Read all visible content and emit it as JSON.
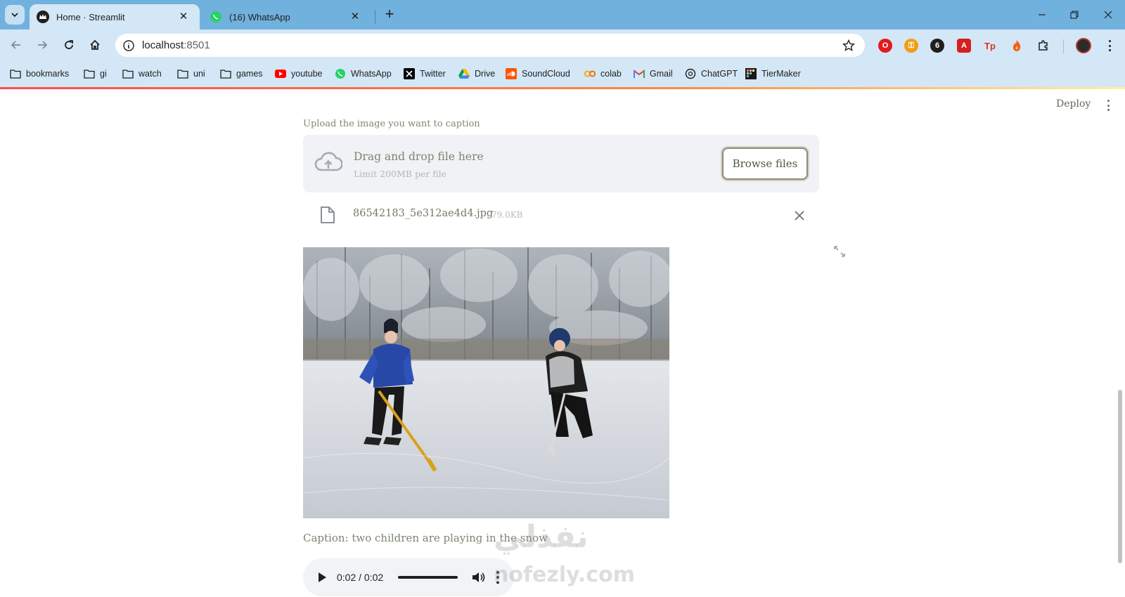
{
  "browser": {
    "tabs": [
      {
        "title": "Home · Streamlit",
        "active": true,
        "icon": "streamlit-crown-icon"
      },
      {
        "title": "(16) WhatsApp",
        "active": false,
        "icon": "whatsapp-icon"
      }
    ],
    "url": {
      "host": "localhost",
      "port": ":8501"
    },
    "bookmarks": [
      {
        "label": "bookmarks",
        "icon": "folder-icon"
      },
      {
        "label": "gi",
        "icon": "folder-icon"
      },
      {
        "label": "watch",
        "icon": "folder-icon"
      },
      {
        "label": "uni",
        "icon": "folder-icon"
      },
      {
        "label": "games",
        "icon": "folder-icon"
      },
      {
        "label": "youtube",
        "icon": "youtube-icon"
      },
      {
        "label": "WhatsApp",
        "icon": "whatsapp-icon"
      },
      {
        "label": "Twitter",
        "icon": "x-icon"
      },
      {
        "label": "Drive",
        "icon": "drive-icon"
      },
      {
        "label": "SoundCloud",
        "icon": "soundcloud-icon"
      },
      {
        "label": "colab",
        "icon": "colab-icon"
      },
      {
        "label": "Gmail",
        "icon": "gmail-icon"
      },
      {
        "label": "ChatGPT",
        "icon": "chatgpt-icon"
      },
      {
        "label": "TierMaker",
        "icon": "tiermaker-icon"
      }
    ],
    "extension_labels": {
      "tp": "Tp"
    }
  },
  "app": {
    "header": {
      "deploy_label": "Deploy"
    },
    "uploader": {
      "label": "Upload the image you want to caption",
      "drop_title": "Drag and drop file here",
      "limit": "Limit 200MB per file",
      "browse_label": "Browse files"
    },
    "uploaded_file": {
      "name": "86542183_5e312ae4d4.jpg",
      "size": "79.0KB"
    },
    "image": {
      "subject": "two children playing ice hockey on a frozen lake with snowy trees"
    },
    "caption": "Caption: two children are playing in the snow",
    "audio": {
      "time": "0:02 / 0:02",
      "progress": 1.0
    }
  },
  "watermark": {
    "arabic": "نفذلي",
    "latin": "nofezly.com"
  },
  "colors": {
    "tabstrip": "#71b1de",
    "toolbar": "#d3e7f6",
    "text_muted": "#7a8771",
    "dropzone": "#f0f2f6"
  }
}
